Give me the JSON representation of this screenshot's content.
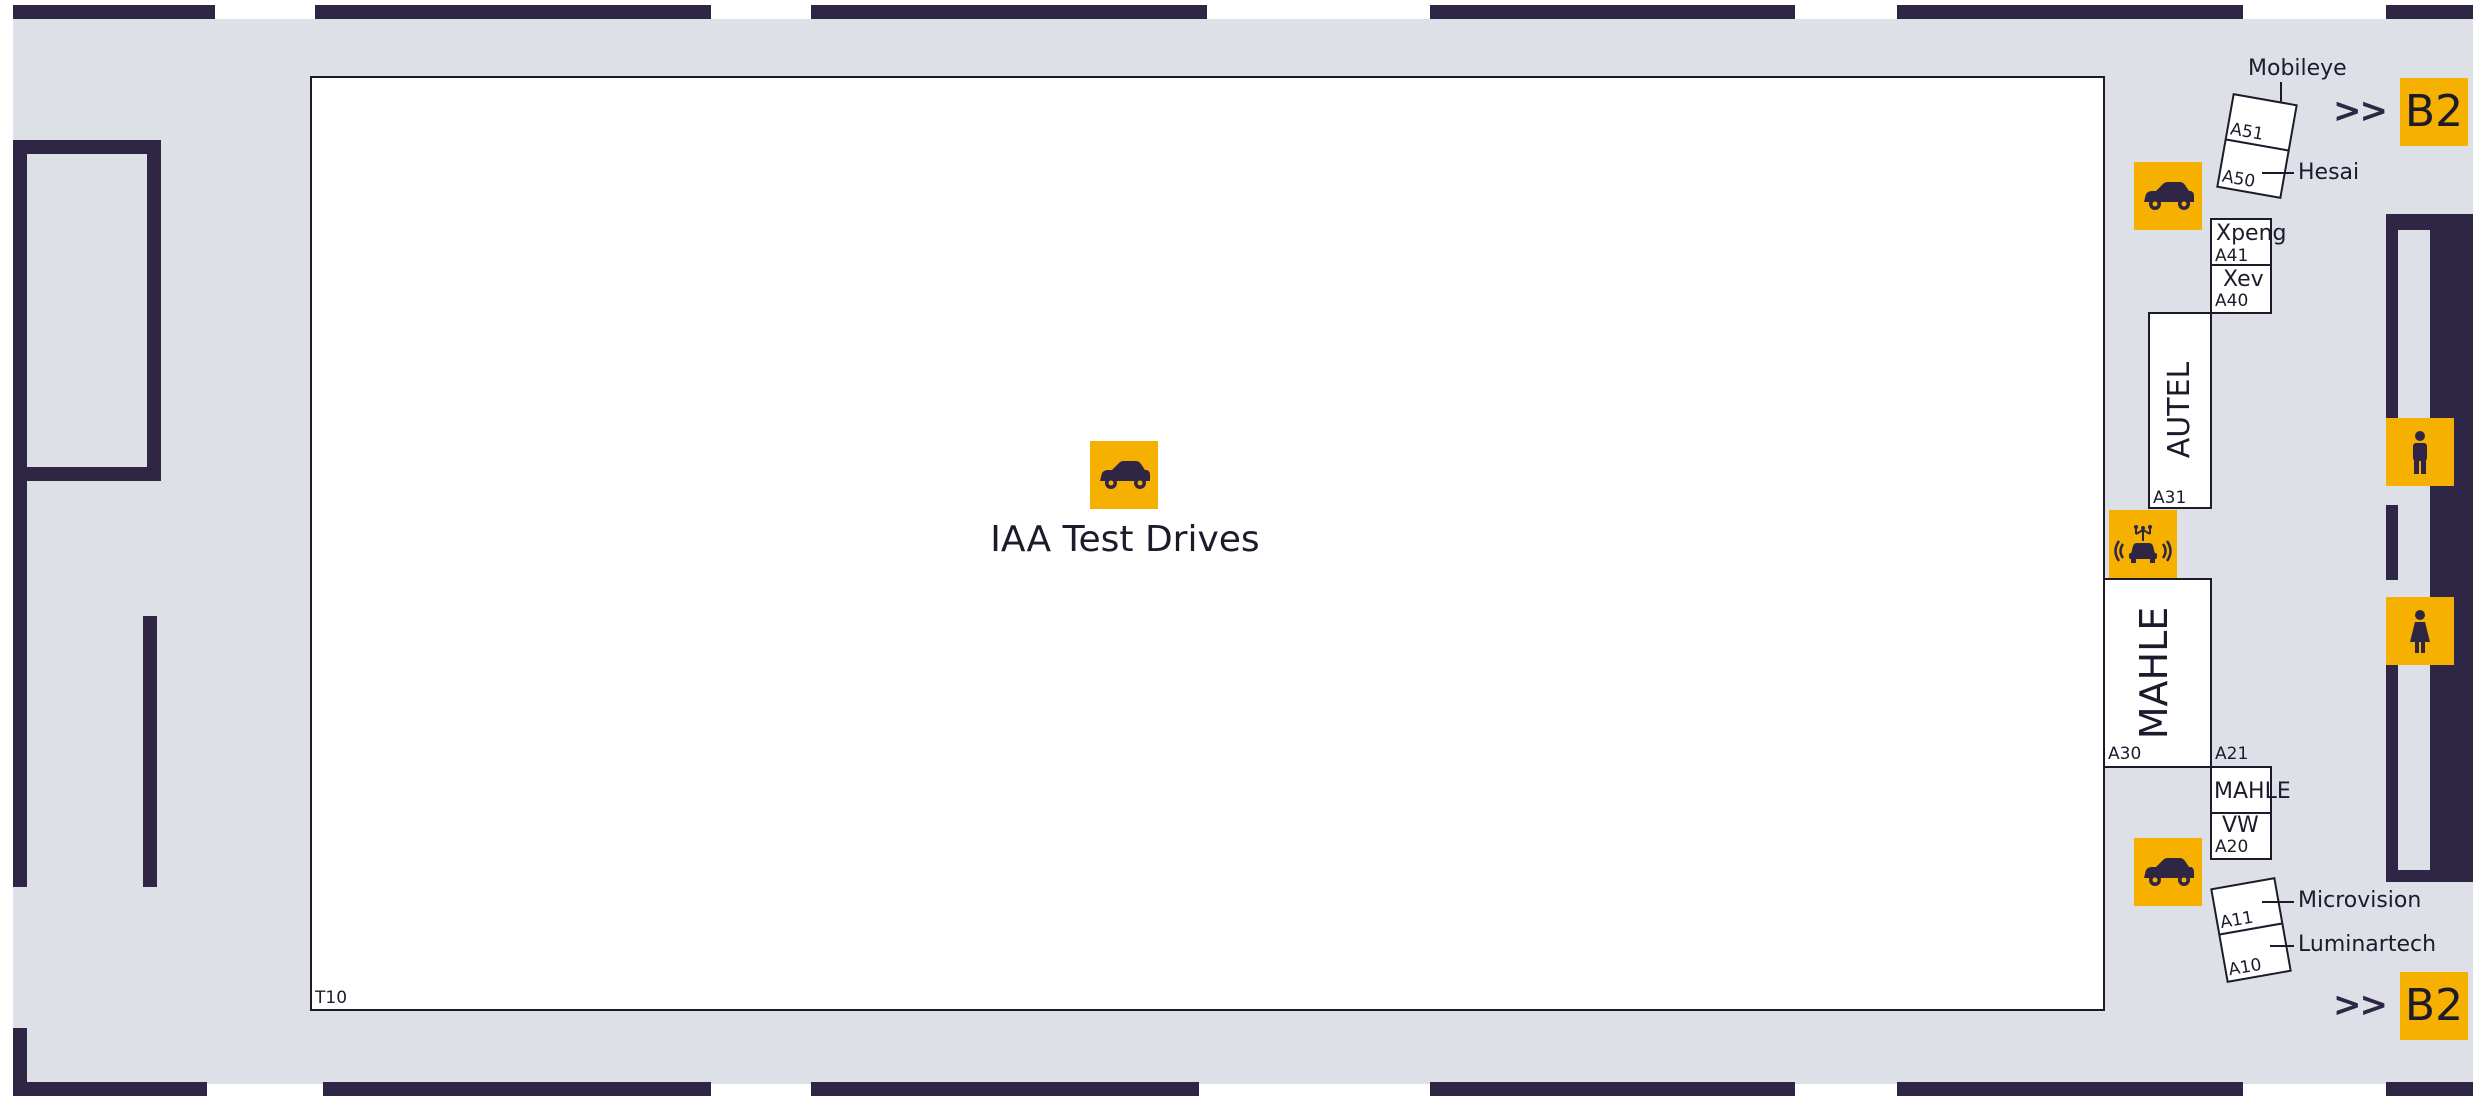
{
  "main_area": {
    "title": "IAA Test Drives",
    "number": "T10"
  },
  "booths": {
    "mobileye": "Mobileye",
    "a51": "A51",
    "hesai": "Hesai",
    "a50": "A50",
    "xpeng": "Xpeng",
    "a41": "A41",
    "xev": "Xev",
    "a40": "A40",
    "autel": "AUTEL",
    "a31": "A31",
    "mahle_large": "MAHLE",
    "a30": "A30",
    "a21": "A21",
    "mahle_small": "MAHLE",
    "vw": "VW",
    "a20": "A20",
    "microvision": "Microvision",
    "a11": "A11",
    "luminartech": "Luminartech",
    "a10": "A10"
  },
  "exits": {
    "top_arrows": ">>",
    "top_label": "B2",
    "bottom_arrows": ">>",
    "bottom_label": "B2"
  },
  "icons": [
    "car-icon",
    "autonomous-car-icon",
    "men-restroom-icon",
    "women-restroom-icon"
  ],
  "colors": {
    "accent": "#f6b100",
    "wall": "#2e2644",
    "floor": "#dde1e7"
  }
}
